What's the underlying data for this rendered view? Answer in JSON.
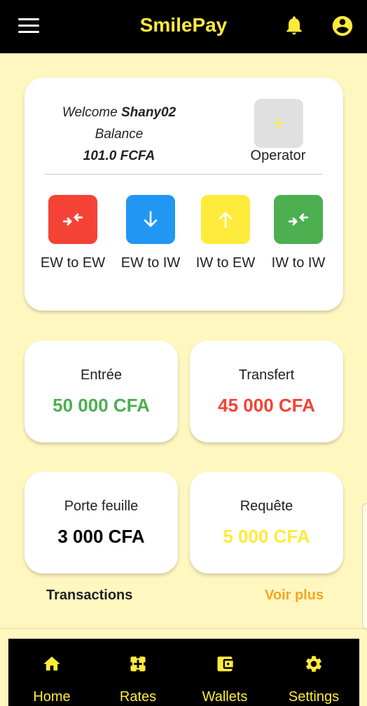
{
  "appbar": {
    "title": "SmilePay",
    "icons": [
      "menu-icon",
      "bell-icon",
      "account-circle-icon"
    ]
  },
  "welcome": {
    "prefix": "Welcome",
    "username": "Shany02",
    "balance_label": "Balance",
    "balance_value": "101.0 FCFA",
    "operator_label": "Operator"
  },
  "actions": [
    {
      "label": "EW to EW",
      "color": "#f44336",
      "icon": "swap-arrows-icon"
    },
    {
      "label": "EW to IW",
      "color": "#2196f3",
      "icon": "arrow-down-icon"
    },
    {
      "label": "IW to EW",
      "color": "#ffeb3b",
      "icon": "arrow-up-icon"
    },
    {
      "label": "IW to IW",
      "color": "#4caf50",
      "icon": "swap-arrows-icon"
    }
  ],
  "stats": [
    {
      "label": "Entrée",
      "value": "50 000 CFA",
      "color": "#4caf50"
    },
    {
      "label": "Transfert",
      "value": "45 000 CFA",
      "color": "#f44336"
    },
    {
      "label": "Porte feuille",
      "value": "3 000 CFA",
      "color": "#000000"
    },
    {
      "label": "Requête",
      "value": "5 000 CFA",
      "color": "#ffeb3b"
    }
  ],
  "transactions": {
    "title": "Transactions",
    "more": "Voir plus"
  },
  "nav": [
    {
      "label": "Home",
      "icon": "home-icon"
    },
    {
      "label": "Rates",
      "icon": "rates-icon"
    },
    {
      "label": "Wallets",
      "icon": "wallet-icon"
    },
    {
      "label": "Settings",
      "icon": "gear-icon"
    }
  ],
  "colors": {
    "accent": "#ffeb3b",
    "background": "#fff7c0",
    "bar": "#000000",
    "link": "#f5a623"
  }
}
